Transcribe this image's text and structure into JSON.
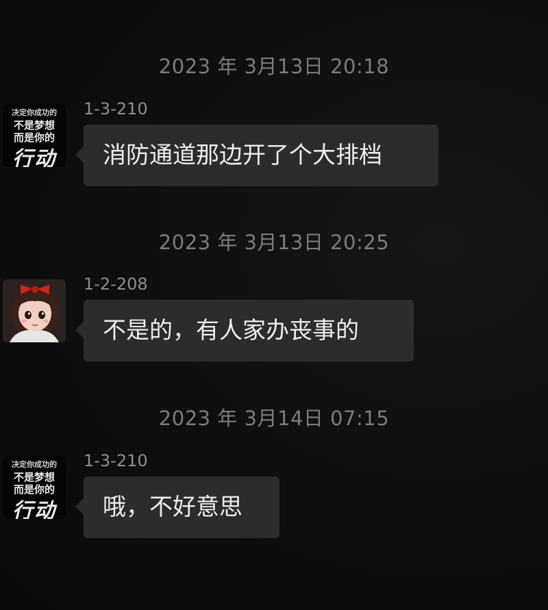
{
  "messages": [
    {
      "timestamp": "2023 年 3月13日 20:18",
      "sender": "1-3-210",
      "avatar": "motivational-text-avatar",
      "text": "消防通道那边开了个大排档"
    },
    {
      "timestamp": "2023 年 3月13日 20:25",
      "sender": "1-2-208",
      "avatar": "girl-with-red-bow-avatar",
      "text": "不是的，有人家办丧事的"
    },
    {
      "timestamp": "2023 年 3月14日 07:15",
      "sender": "1-3-210",
      "avatar": "motivational-text-avatar",
      "text": "哦，不好意思"
    }
  ],
  "avatar_text": {
    "line1": "决定你成功的",
    "line2": "不是梦想",
    "line3": "而是你的",
    "line4": "行动"
  },
  "colors": {
    "background": "#0d0d0f",
    "bubble": "#2c2c2e",
    "timestamp": "#7b7b7f",
    "sender": "#8e8e92",
    "bubble_text": "#ededed",
    "bow": "#d0221e"
  }
}
